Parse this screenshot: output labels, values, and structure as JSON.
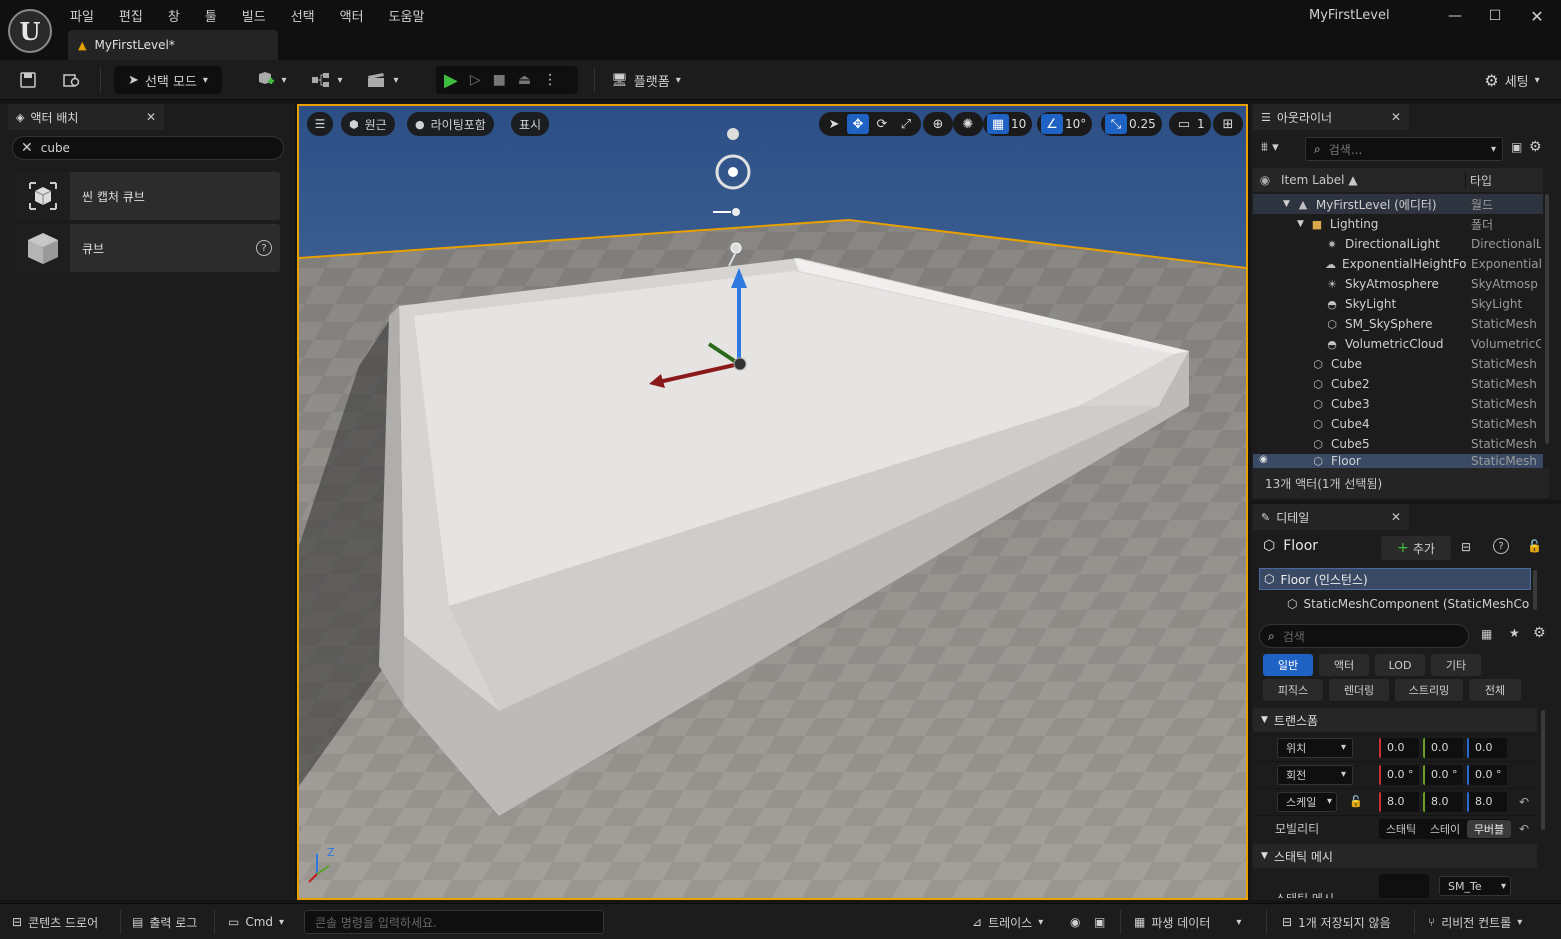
{
  "app": {
    "logo_text": "U",
    "menu": [
      "파일",
      "편집",
      "창",
      "툴",
      "빌드",
      "선택",
      "액터",
      "도움말"
    ],
    "doc_tab": "MyFirstLevel*",
    "window_title": "MyFirstLevel"
  },
  "toolbar": {
    "select_mode": "선택 모드",
    "platform": "플랫폼",
    "settings": "세팅"
  },
  "place_actors": {
    "tab_label": "액터 배치",
    "search_value": "cube",
    "items": [
      "씬 캡처 큐브",
      "큐브"
    ]
  },
  "viewport": {
    "perspective": "원근",
    "lit": "라이팅포함",
    "show": "표시",
    "grid_snap": "10",
    "rotate_snap": "10°",
    "scale_snap": "0.25",
    "camera_speed": "1",
    "axis_z": "Z"
  },
  "outliner": {
    "tab_label": "아웃라이너",
    "search_placeholder": "검색...",
    "col_label": "Item Label ▲",
    "col_type": "타입",
    "rows": [
      {
        "label": "MyFirstLevel (에디터)",
        "type": "월드"
      },
      {
        "label": "Lighting",
        "type": "폴더"
      },
      {
        "label": "DirectionalLight",
        "type": "DirectionalL"
      },
      {
        "label": "ExponentialHeightFog",
        "type": "Exponential"
      },
      {
        "label": "SkyAtmosphere",
        "type": "SkyAtmosp"
      },
      {
        "label": "SkyLight",
        "type": "SkyLight"
      },
      {
        "label": "SM_SkySphere",
        "type": "StaticMesh"
      },
      {
        "label": "VolumetricCloud",
        "type": "VolumetricC"
      },
      {
        "label": "Cube",
        "type": "StaticMesh"
      },
      {
        "label": "Cube2",
        "type": "StaticMesh"
      },
      {
        "label": "Cube3",
        "type": "StaticMesh"
      },
      {
        "label": "Cube4",
        "type": "StaticMesh"
      },
      {
        "label": "Cube5",
        "type": "StaticMesh"
      },
      {
        "label": "Floor",
        "type": "StaticMesh"
      }
    ],
    "footer": "13개 액터(1개 선택됨)"
  },
  "details": {
    "tab_label": "디테일",
    "object_name": "Floor",
    "add_button": "추가",
    "instance_row": "Floor (인스턴스)",
    "component_row": "StaticMeshComponent (StaticMeshCo",
    "search_placeholder": "검색",
    "filters_row1": [
      "일반",
      "액터",
      "LOD",
      "기타"
    ],
    "filters_row2": [
      "피직스",
      "렌더링",
      "스트리밍",
      "전체"
    ],
    "transform_header": "트랜스폼",
    "location_label": "위치",
    "location": [
      "0.0",
      "0.0",
      "0.0"
    ],
    "rotation_label": "회전",
    "rotation": [
      "0.0 °",
      "0.0 °",
      "0.0 °"
    ],
    "scale_label": "스케일",
    "scale": [
      "8.0",
      "8.0",
      "8.0"
    ],
    "mobility_label": "모빌리티",
    "mobility_options": [
      "스태틱",
      "스테이",
      "무버블"
    ],
    "static_mesh_header": "스태틱 메시",
    "static_mesh_label": "스태틱 메시",
    "mesh_value": "SM_Te"
  },
  "statusbar": {
    "content_drawer": "콘텐츠 드로어",
    "output_log": "출력 로그",
    "cmd": "Cmd",
    "console_placeholder": "콘솔 명령을 입력하세요.",
    "trace": "트레이스",
    "derived_data": "파생 데이터",
    "unsaved": "1개 저장되지 않음",
    "revision": "리비전 컨트롤"
  }
}
